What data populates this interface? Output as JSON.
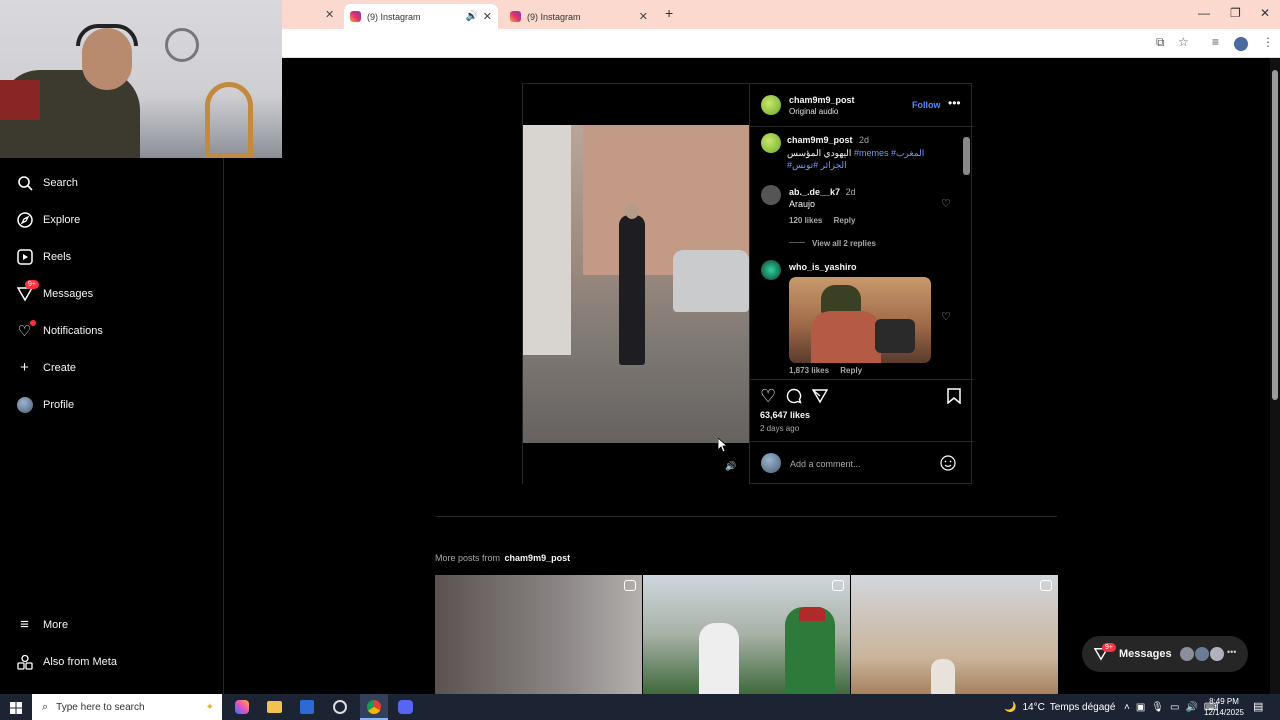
{
  "browser": {
    "tabs": [
      {
        "label": "(9) Instagram",
        "active": true
      },
      {
        "label": "(9) Instagram",
        "active": false
      }
    ],
    "new_tab": "+"
  },
  "sidebar": {
    "items": [
      {
        "label": "Search",
        "icon": "search-icon"
      },
      {
        "label": "Explore",
        "icon": "compass-icon"
      },
      {
        "label": "Reels",
        "icon": "reels-icon"
      },
      {
        "label": "Messages",
        "icon": "messenger-icon",
        "badge": "9+"
      },
      {
        "label": "Notifications",
        "icon": "heart-icon"
      },
      {
        "label": "Create",
        "icon": "plus-icon"
      },
      {
        "label": "Profile",
        "icon": "profile-avatar"
      }
    ],
    "more": "More",
    "meta": "Also from Meta"
  },
  "post": {
    "username": "cham9m9_post",
    "audio": "Original audio",
    "follow": "Follow",
    "caption": {
      "username": "cham9m9_post",
      "time": "2d",
      "text": "اليهودي المؤسس",
      "tags": "#memes #المغرب",
      "tags2": "#الجزائر #تونس"
    },
    "comments": [
      {
        "username": "ab._.de__k7",
        "time": "2d",
        "text": "Araujo",
        "likes": "120 likes",
        "reply": "Reply",
        "view_replies": "View all 2 replies"
      },
      {
        "username": "who_is_yashiro",
        "likes": "1,873 likes",
        "reply": "Reply"
      }
    ],
    "likes": "63,647 likes",
    "age": "2 days ago",
    "add_comment": "Add a comment..."
  },
  "more_posts": {
    "label": "More posts from",
    "username": "cham9m9_post"
  },
  "messages_pill": {
    "label": "Messages",
    "badge": "9+"
  },
  "taskbar": {
    "search_placeholder": "Type here to search",
    "weather": "14°C",
    "weather_text": "Temps dégagé",
    "time": "8:49 PM",
    "date": "12/14/2025"
  }
}
